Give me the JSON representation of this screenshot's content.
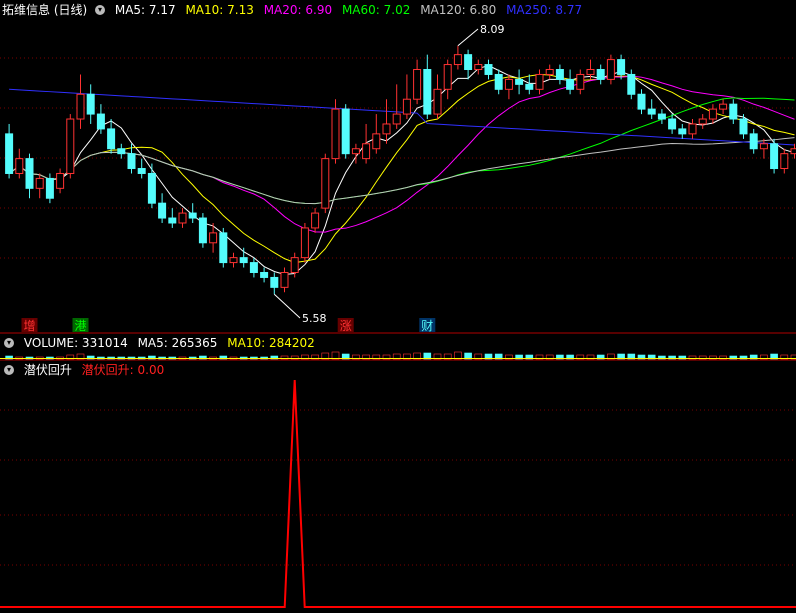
{
  "stock": {
    "title": "拓维信息 (日线)"
  },
  "indicators": {
    "ma5": "MA5: 7.17",
    "ma10": "MA10: 7.13",
    "ma20": "MA20: 6.90",
    "ma60": "MA60: 7.02",
    "ma120": "MA120: 6.80",
    "ma250": "MA250: 8.77"
  },
  "volume_header": {
    "volume": "VOLUME: 331014",
    "ma5": "MA5: 265365",
    "ma10": "MA10: 284202"
  },
  "signal_header": {
    "title": "潜伏回升",
    "value": "潜伏回升: 0.00"
  },
  "annotations": {
    "high": "8.09",
    "low": "5.58"
  },
  "markers": [
    "增",
    "港",
    "涨",
    "财"
  ],
  "colors": {
    "up": "#ff3232",
    "down": "#54fcfc",
    "ma5": "#ffffff",
    "ma10": "#ffff00",
    "ma20": "#ff00ff",
    "ma60": "#00ff00",
    "ma120": "#c0c0c0",
    "ma250": "#3030ff",
    "signal": "#ff0000",
    "grid": "#7a0000",
    "divider": "#b00000"
  },
  "chart_data": {
    "type": "candlestick",
    "ylim": [
      5.3,
      8.35
    ],
    "candles": [
      [
        7.2,
        7.3,
        6.75,
        6.8
      ],
      [
        6.8,
        7.05,
        6.75,
        6.95
      ],
      [
        6.95,
        7.0,
        6.55,
        6.65
      ],
      [
        6.65,
        6.8,
        6.55,
        6.75
      ],
      [
        6.75,
        6.8,
        6.5,
        6.55
      ],
      [
        6.65,
        6.85,
        6.6,
        6.8
      ],
      [
        6.8,
        7.4,
        6.75,
        7.35
      ],
      [
        7.35,
        7.8,
        7.25,
        7.6
      ],
      [
        7.6,
        7.7,
        7.3,
        7.4
      ],
      [
        7.4,
        7.5,
        7.2,
        7.25
      ],
      [
        7.25,
        7.35,
        7.0,
        7.05
      ],
      [
        7.05,
        7.1,
        6.95,
        7.0
      ],
      [
        7.0,
        7.1,
        6.8,
        6.85
      ],
      [
        6.85,
        6.95,
        6.75,
        6.8
      ],
      [
        6.8,
        6.9,
        6.45,
        6.5
      ],
      [
        6.5,
        6.6,
        6.3,
        6.35
      ],
      [
        6.35,
        6.45,
        6.25,
        6.3
      ],
      [
        6.3,
        6.45,
        6.25,
        6.4
      ],
      [
        6.4,
        6.5,
        6.3,
        6.35
      ],
      [
        6.35,
        6.4,
        6.05,
        6.1
      ],
      [
        6.1,
        6.3,
        6.0,
        6.2
      ],
      [
        6.2,
        6.25,
        5.85,
        5.9
      ],
      [
        5.9,
        6.0,
        5.85,
        5.95
      ],
      [
        5.95,
        6.05,
        5.85,
        5.9
      ],
      [
        5.9,
        5.95,
        5.75,
        5.8
      ],
      [
        5.8,
        5.85,
        5.7,
        5.75
      ],
      [
        5.75,
        5.8,
        5.58,
        5.65
      ],
      [
        5.65,
        5.85,
        5.6,
        5.8
      ],
      [
        5.8,
        6.0,
        5.75,
        5.95
      ],
      [
        5.95,
        6.3,
        5.9,
        6.25
      ],
      [
        6.25,
        6.45,
        6.2,
        6.4
      ],
      [
        6.45,
        7.0,
        6.4,
        6.95
      ],
      [
        6.95,
        7.55,
        6.9,
        7.45
      ],
      [
        7.45,
        7.5,
        6.95,
        7.0
      ],
      [
        7.0,
        7.1,
        6.9,
        7.05
      ],
      [
        6.95,
        7.3,
        6.9,
        7.1
      ],
      [
        7.05,
        7.4,
        7.0,
        7.2
      ],
      [
        7.2,
        7.55,
        7.1,
        7.3
      ],
      [
        7.3,
        7.7,
        7.25,
        7.4
      ],
      [
        7.4,
        7.8,
        7.35,
        7.55
      ],
      [
        7.55,
        7.95,
        7.5,
        7.85
      ],
      [
        7.85,
        8.0,
        7.35,
        7.4
      ],
      [
        7.4,
        7.8,
        7.35,
        7.65
      ],
      [
        7.65,
        7.95,
        7.55,
        7.9
      ],
      [
        7.9,
        8.09,
        7.85,
        8.0
      ],
      [
        8.0,
        8.05,
        7.75,
        7.85
      ],
      [
        7.85,
        7.95,
        7.8,
        7.9
      ],
      [
        7.9,
        7.95,
        7.75,
        7.8
      ],
      [
        7.8,
        7.85,
        7.6,
        7.65
      ],
      [
        7.65,
        7.8,
        7.55,
        7.75
      ],
      [
        7.75,
        7.85,
        7.6,
        7.7
      ],
      [
        7.7,
        7.8,
        7.6,
        7.65
      ],
      [
        7.65,
        7.85,
        7.6,
        7.8
      ],
      [
        7.8,
        7.9,
        7.75,
        7.85
      ],
      [
        7.85,
        7.9,
        7.7,
        7.75
      ],
      [
        7.75,
        7.85,
        7.6,
        7.65
      ],
      [
        7.65,
        7.85,
        7.6,
        7.8
      ],
      [
        7.8,
        7.95,
        7.75,
        7.85
      ],
      [
        7.85,
        7.9,
        7.7,
        7.75
      ],
      [
        7.75,
        8.0,
        7.7,
        7.95
      ],
      [
        7.95,
        8.0,
        7.75,
        7.8
      ],
      [
        7.8,
        7.85,
        7.55,
        7.6
      ],
      [
        7.6,
        7.65,
        7.4,
        7.45
      ],
      [
        7.45,
        7.55,
        7.35,
        7.4
      ],
      [
        7.4,
        7.45,
        7.3,
        7.35
      ],
      [
        7.35,
        7.4,
        7.2,
        7.25
      ],
      [
        7.25,
        7.3,
        7.15,
        7.2
      ],
      [
        7.2,
        7.35,
        7.15,
        7.3
      ],
      [
        7.3,
        7.4,
        7.25,
        7.35
      ],
      [
        7.35,
        7.5,
        7.3,
        7.45
      ],
      [
        7.45,
        7.55,
        7.4,
        7.5
      ],
      [
        7.5,
        7.55,
        7.3,
        7.35
      ],
      [
        7.35,
        7.4,
        7.15,
        7.2
      ],
      [
        7.2,
        7.25,
        7.0,
        7.05
      ],
      [
        7.05,
        7.15,
        6.95,
        7.1
      ],
      [
        7.1,
        7.15,
        6.8,
        6.85
      ],
      [
        6.85,
        7.05,
        6.8,
        7.0
      ],
      [
        7.0,
        7.1,
        6.95,
        7.05
      ]
    ],
    "volume": [
      3,
      2,
      2,
      2,
      2,
      2,
      4,
      5,
      3,
      2,
      2,
      2,
      2,
      2,
      3,
      2,
      2,
      2,
      2,
      3,
      2,
      3,
      2,
      2,
      2,
      2,
      3,
      3,
      3,
      4,
      4,
      6,
      7,
      5,
      4,
      4,
      4,
      4,
      5,
      5,
      6,
      6,
      5,
      5,
      7,
      6,
      5,
      5,
      5,
      4,
      4,
      4,
      4,
      4,
      4,
      4,
      4,
      4,
      4,
      5,
      5,
      5,
      4,
      4,
      3,
      3,
      3,
      3,
      3,
      3,
      3,
      3,
      3,
      4,
      4,
      5,
      4,
      4
    ],
    "signal": {
      "peak_index": 28,
      "peak_value": 1,
      "baseline": 0
    }
  }
}
